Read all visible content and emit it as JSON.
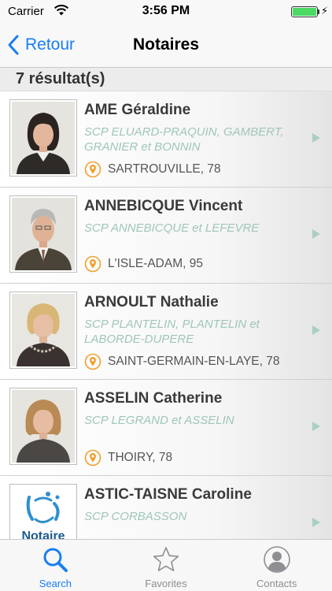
{
  "status_bar": {
    "carrier": "Carrier",
    "time": "3:56 PM",
    "battery_level": 1.0,
    "icons": [
      "wifi-icon",
      "battery-icon",
      "charging-bolt-icon"
    ]
  },
  "nav": {
    "back_label": "Retour",
    "title": "Notaires"
  },
  "results": {
    "header": "7 résultat(s)"
  },
  "notaires": [
    {
      "name": "AME Géraldine",
      "office": "SCP ELUARD-PRAQUIN, GAMBERT, GRANIER et BONNIN",
      "city": "SARTROUVILLE, 78"
    },
    {
      "name": "ANNEBICQUE Vincent",
      "office": "SCP ANNEBICQUE et LEFEVRE",
      "city": "L'ISLE-ADAM, 95"
    },
    {
      "name": "ARNOULT Nathalie",
      "office": "SCP PLANTELIN, PLANTELIN et LABORDE-DUPERE",
      "city": "SAINT-GERMAIN-EN-LAYE, 78"
    },
    {
      "name": "ASSELIN Catherine",
      "office": "SCP LEGRAND et ASSELIN",
      "city": "THOIRY, 78"
    },
    {
      "name": "ASTIC-TAISNE Caroline",
      "office": "SCP CORBASSON",
      "city": "",
      "logo_text": "Notaire"
    }
  ],
  "tab_bar": {
    "tabs": [
      {
        "label": "Search",
        "icon": "search-icon",
        "active": true
      },
      {
        "label": "Favorites",
        "icon": "star-icon",
        "active": false
      },
      {
        "label": "Contacts",
        "icon": "contact-icon",
        "active": false
      }
    ]
  },
  "colors": {
    "accent": "#1a7ef2",
    "office_text": "#9fc6b9",
    "pin": "#f0a030",
    "name_text": "#3a3a3a"
  }
}
